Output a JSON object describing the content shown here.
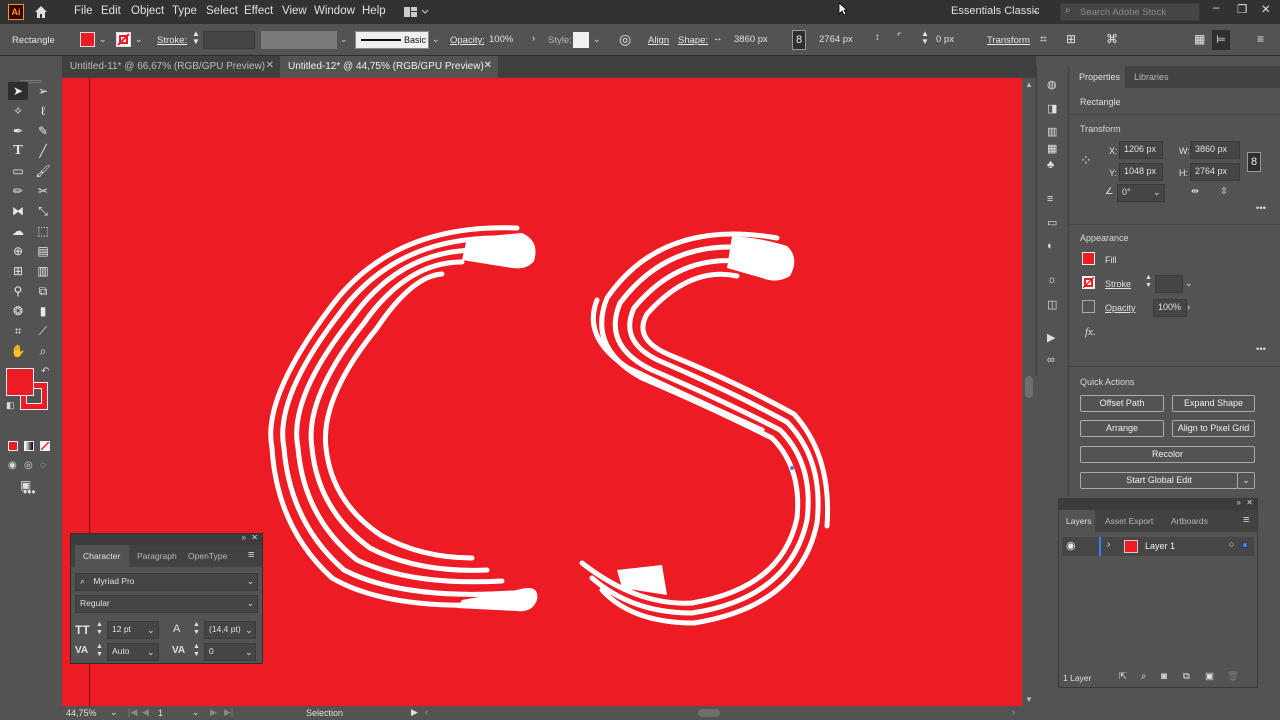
{
  "menubar": {
    "app_icon": "Ai",
    "items": [
      "File",
      "Edit",
      "Object",
      "Type",
      "Select",
      "Effect",
      "View",
      "Window",
      "Help"
    ],
    "workspace": "Essentials Classic",
    "search_placeholder": "Search Adobe Stock"
  },
  "control": {
    "object_type": "Rectangle",
    "fill_color": "#ed1c24",
    "stroke_label": "Stroke:",
    "brush_label": "Basic",
    "opacity_label": "Opacity:",
    "opacity_value": "100%",
    "style_label": "Style:",
    "align_label": "Align",
    "shape_label": "Shape:",
    "width_value": "3860 px",
    "height_value": "2764 px",
    "radius_value": "0 px",
    "transform_label": "Transform"
  },
  "tabs": [
    {
      "label": "Untitled-11* @ 66,67% (RGB/GPU Preview)",
      "active": false
    },
    {
      "label": "Untitled-12* @ 44,75% (RGB/GPU Preview)",
      "active": true
    }
  ],
  "status": {
    "zoom": "44,75%",
    "artboard": "1",
    "tool": "Selection"
  },
  "properties": {
    "tabs": [
      "Properties",
      "Libraries"
    ],
    "object_type": "Rectangle",
    "transform_header": "Transform",
    "x_label": "X:",
    "x_value": "1206 px",
    "y_label": "Y:",
    "y_value": "1048 px",
    "w_label": "W:",
    "w_value": "3860 px",
    "h_label": "H:",
    "h_value": "2764 px",
    "angle_value": "0°",
    "appearance_header": "Appearance",
    "fill_label": "Fill",
    "stroke_label": "Stroke",
    "opacity_label": "Opacity",
    "opacity_value": "100%",
    "fx_label": "fx.",
    "quick_actions_header": "Quick Actions",
    "buttons": {
      "offset_path": "Offset Path",
      "expand_shape": "Expand Shape",
      "arrange": "Arrange",
      "align_pixel": "Align to Pixel Grid",
      "recolor": "Recolor",
      "global_edit": "Start Global Edit"
    }
  },
  "layers": {
    "tabs": [
      "Layers",
      "Asset Export",
      "Artboards"
    ],
    "layer_name": "Layer 1",
    "count": "1 Layer"
  },
  "character": {
    "tabs": [
      "Character",
      "Paragraph",
      "OpenType"
    ],
    "font_family": "Myriad Pro",
    "font_style": "Regular",
    "font_size": "12 pt",
    "leading": "(14,4 pt)",
    "kerning": "Auto",
    "tracking": "0"
  },
  "colors": {
    "accent_red": "#ed1c24",
    "selection_blue": "#3d7bff"
  }
}
